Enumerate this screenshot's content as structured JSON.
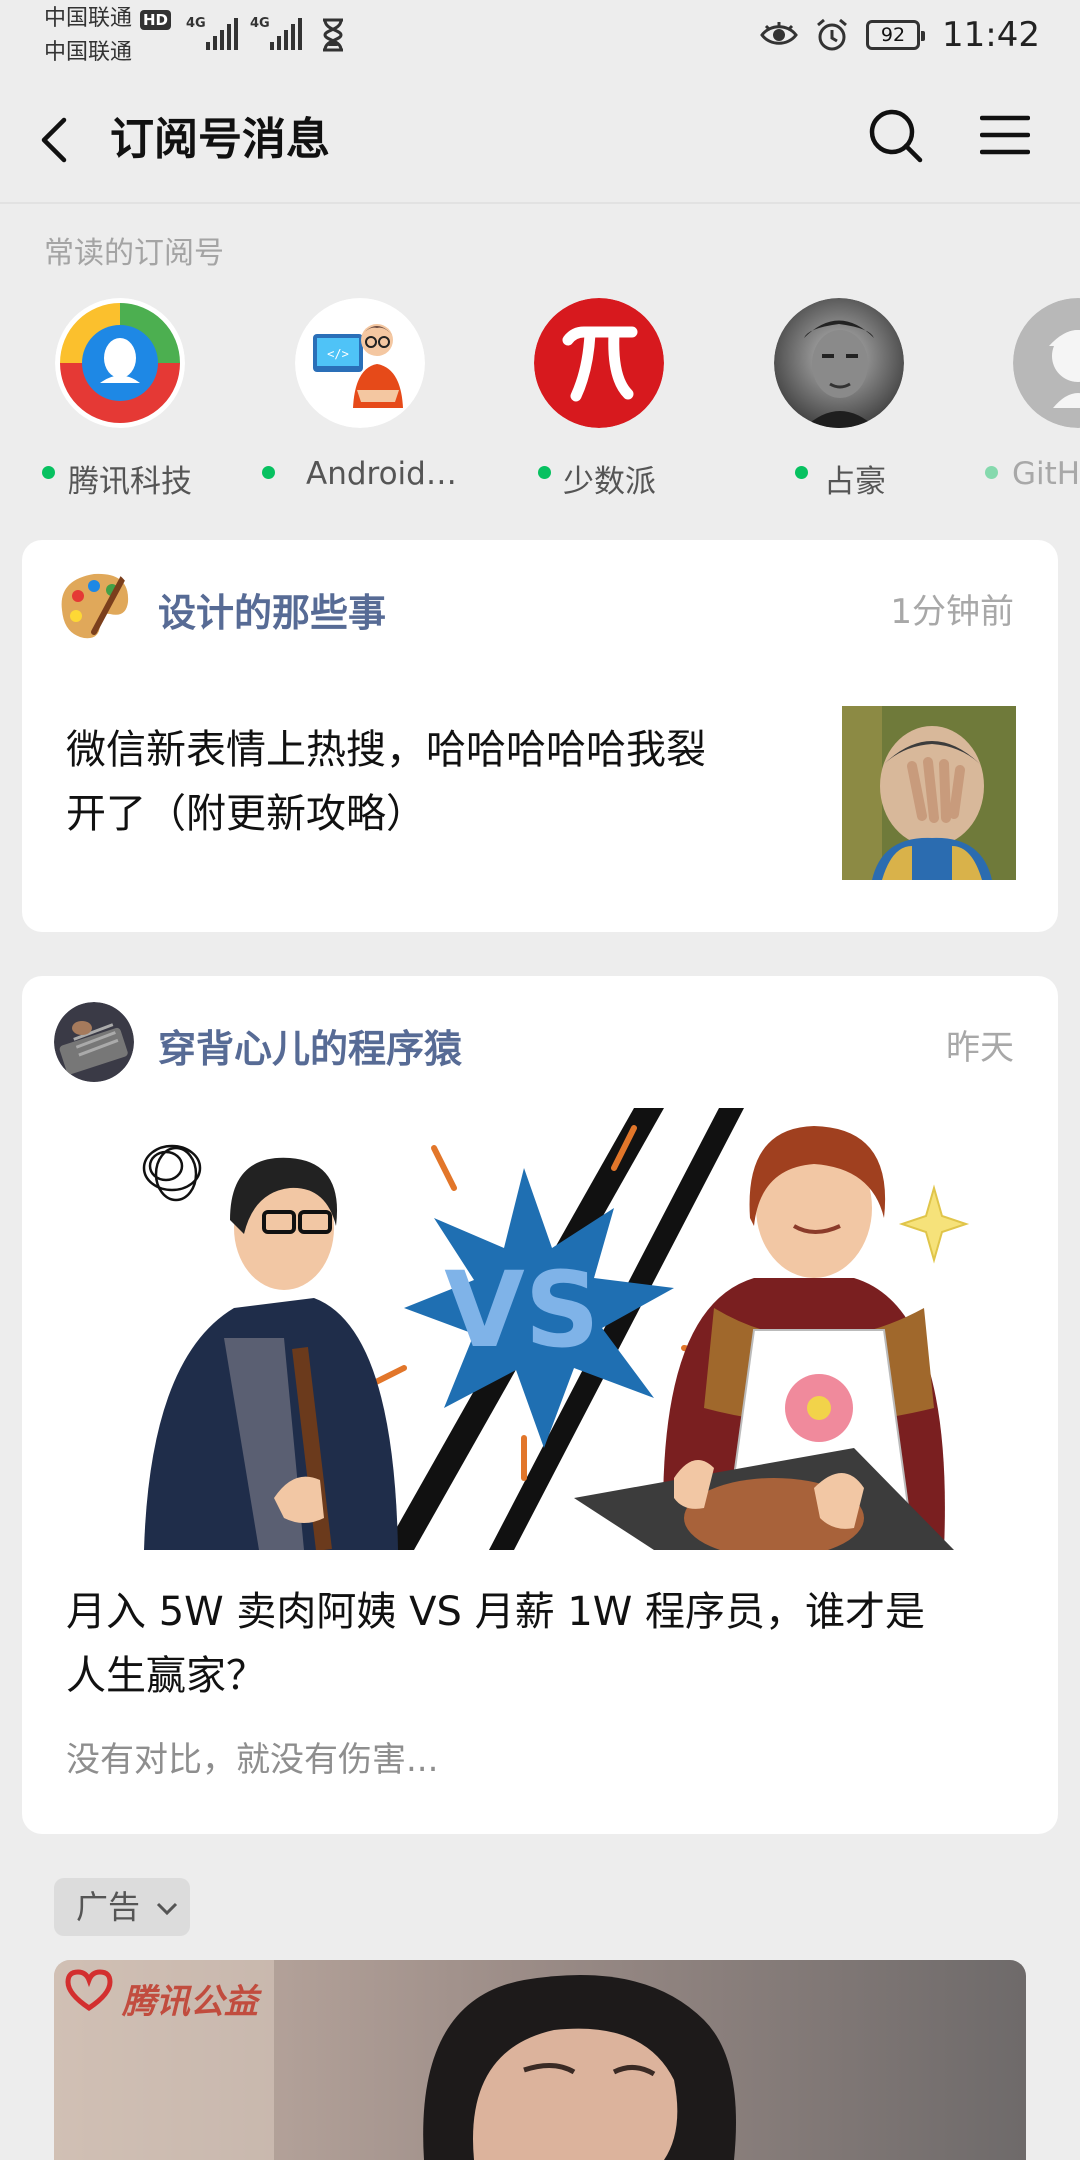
{
  "status_bar": {
    "carrier_1": "中国联通",
    "carrier_2": "中国联通",
    "hd_badge": "HD",
    "signal_1_label": "4G",
    "signal_2_label": "4G",
    "battery": "92",
    "time": "11:42",
    "icons": [
      "hd-icon",
      "signal-icon",
      "hourglass-icon",
      "eye-icon",
      "alarm-icon",
      "battery-icon"
    ]
  },
  "header": {
    "title": "订阅号消息",
    "back_icon": "back-arrow-icon",
    "search_icon": "search-icon",
    "menu_icon": "menu-icon"
  },
  "frequent": {
    "label": "常读的订阅号",
    "accounts": [
      {
        "name": "腾讯科技"
      },
      {
        "name": "Android…"
      },
      {
        "name": "少数派"
      },
      {
        "name": "占豪"
      },
      {
        "name": "GitHu"
      }
    ]
  },
  "feed": [
    {
      "source": "设计的那些事",
      "time": "1分钟前",
      "title_line1": "微信新表情上热搜，哈哈哈哈哈我裂",
      "title_line2": "开了（附更新攻略）"
    },
    {
      "source": "穿背心儿的程序猿",
      "time": "昨天",
      "vs_text": "VS",
      "title_line1": "月入 5W 卖肉阿姨 VS 月薪 1W 程序员，谁才是",
      "title_line2": "人生赢家？",
      "summary": "没有对比，就没有伤害..."
    }
  ],
  "ad": {
    "tag": "广告",
    "brand": "腾讯公益"
  },
  "colors": {
    "background": "#ededed",
    "source_name": "#576b95",
    "unread_dot": "#07c160"
  }
}
